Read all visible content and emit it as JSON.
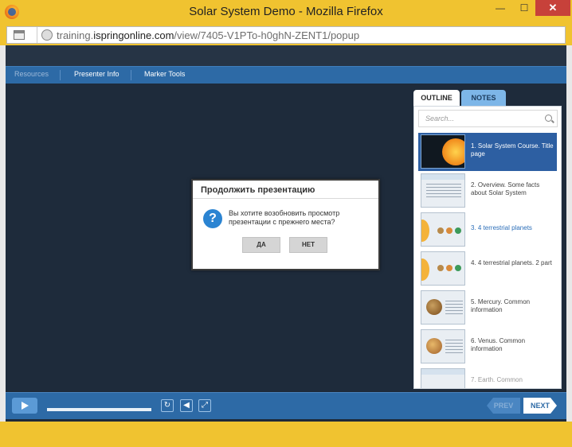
{
  "window": {
    "title": "Solar System Demo - Mozilla Firefox",
    "url_prefix": "training.",
    "url_domain": "ispringonline.com",
    "url_path": "/view/7405-V1PTo-h0ghN-ZENT1/popup"
  },
  "menu": {
    "items": [
      {
        "label": "Resources"
      },
      {
        "label": "Presenter Info"
      },
      {
        "label": "Marker Tools"
      }
    ]
  },
  "dialog": {
    "title": "Продолжить презентацию",
    "message": "Вы хотите возобновить просмотр презентации с прежнего места?",
    "yes_label": "ДА",
    "no_label": "НЕТ",
    "icon": "question-icon"
  },
  "panel": {
    "tab_outline": "OUTLINE",
    "tab_notes": "NOTES",
    "search_placeholder": "Search...",
    "slides": [
      {
        "label": "1. Solar System Course. Title page",
        "active": true
      },
      {
        "label": "2. Overview. Some facts about Solar System"
      },
      {
        "label": "3. 4 terrestrial planets"
      },
      {
        "label": "4. 4 terrestrial planets. 2 part"
      },
      {
        "label": "5. Mercury. Common information"
      },
      {
        "label": "6. Venus. Common information"
      },
      {
        "label": "7. Earth. Common"
      }
    ]
  },
  "player": {
    "prev_label": "PREV",
    "next_label": "NEXT"
  },
  "colors": {
    "accent": "#2d6aa6",
    "stage": "#1e2b3b",
    "title_bar": "#f0c330"
  }
}
